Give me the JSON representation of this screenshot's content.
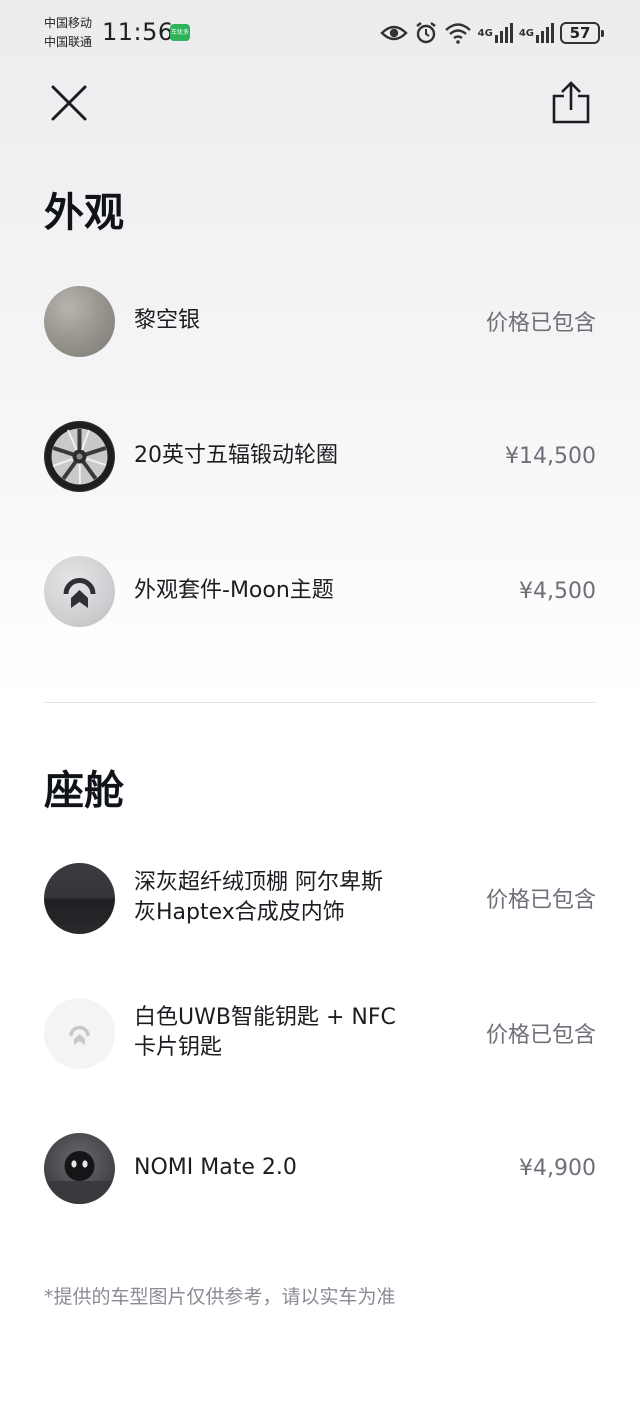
{
  "status_bar": {
    "carrier_1": "中国移动",
    "carrier_2": "中国联通",
    "time": "11:56",
    "app_badge": "车优多",
    "network_1": "4G",
    "network_2": "4G",
    "battery": "57"
  },
  "sections": {
    "exterior": {
      "title": "外观",
      "items": [
        {
          "name": "黎空银",
          "price": "价格已包含",
          "icon": "silver-paint-swatch"
        },
        {
          "name": "20英寸五辐锻动轮圈",
          "price": "¥14,500",
          "icon": "wheel-rim"
        },
        {
          "name": "外观套件-Moon主题",
          "price": "¥4,500",
          "icon": "nio-logo-kit"
        }
      ]
    },
    "cabin": {
      "title": "座舱",
      "items": [
        {
          "name_line1": "深灰超纤绒顶棚 阿尔卑斯",
          "name_line2": "灰Haptex合成皮内饰",
          "price": "价格已包含",
          "icon": "interior-fabric-swatch"
        },
        {
          "name_line1": "白色UWB智能钥匙 + NFC",
          "name_line2": "卡片钥匙",
          "price": "价格已包含",
          "icon": "nio-key"
        },
        {
          "name": "NOMI Mate 2.0",
          "price": "¥4,900",
          "icon": "nomi-robot"
        }
      ]
    }
  },
  "footnote": "*提供的车型图片仅供参考，请以实车为准",
  "colors": {
    "title": "#11131a",
    "text": "#1c1d22",
    "price": "#6e7079",
    "footnote": "#8a8c94",
    "divider": "#e2e3e6"
  }
}
